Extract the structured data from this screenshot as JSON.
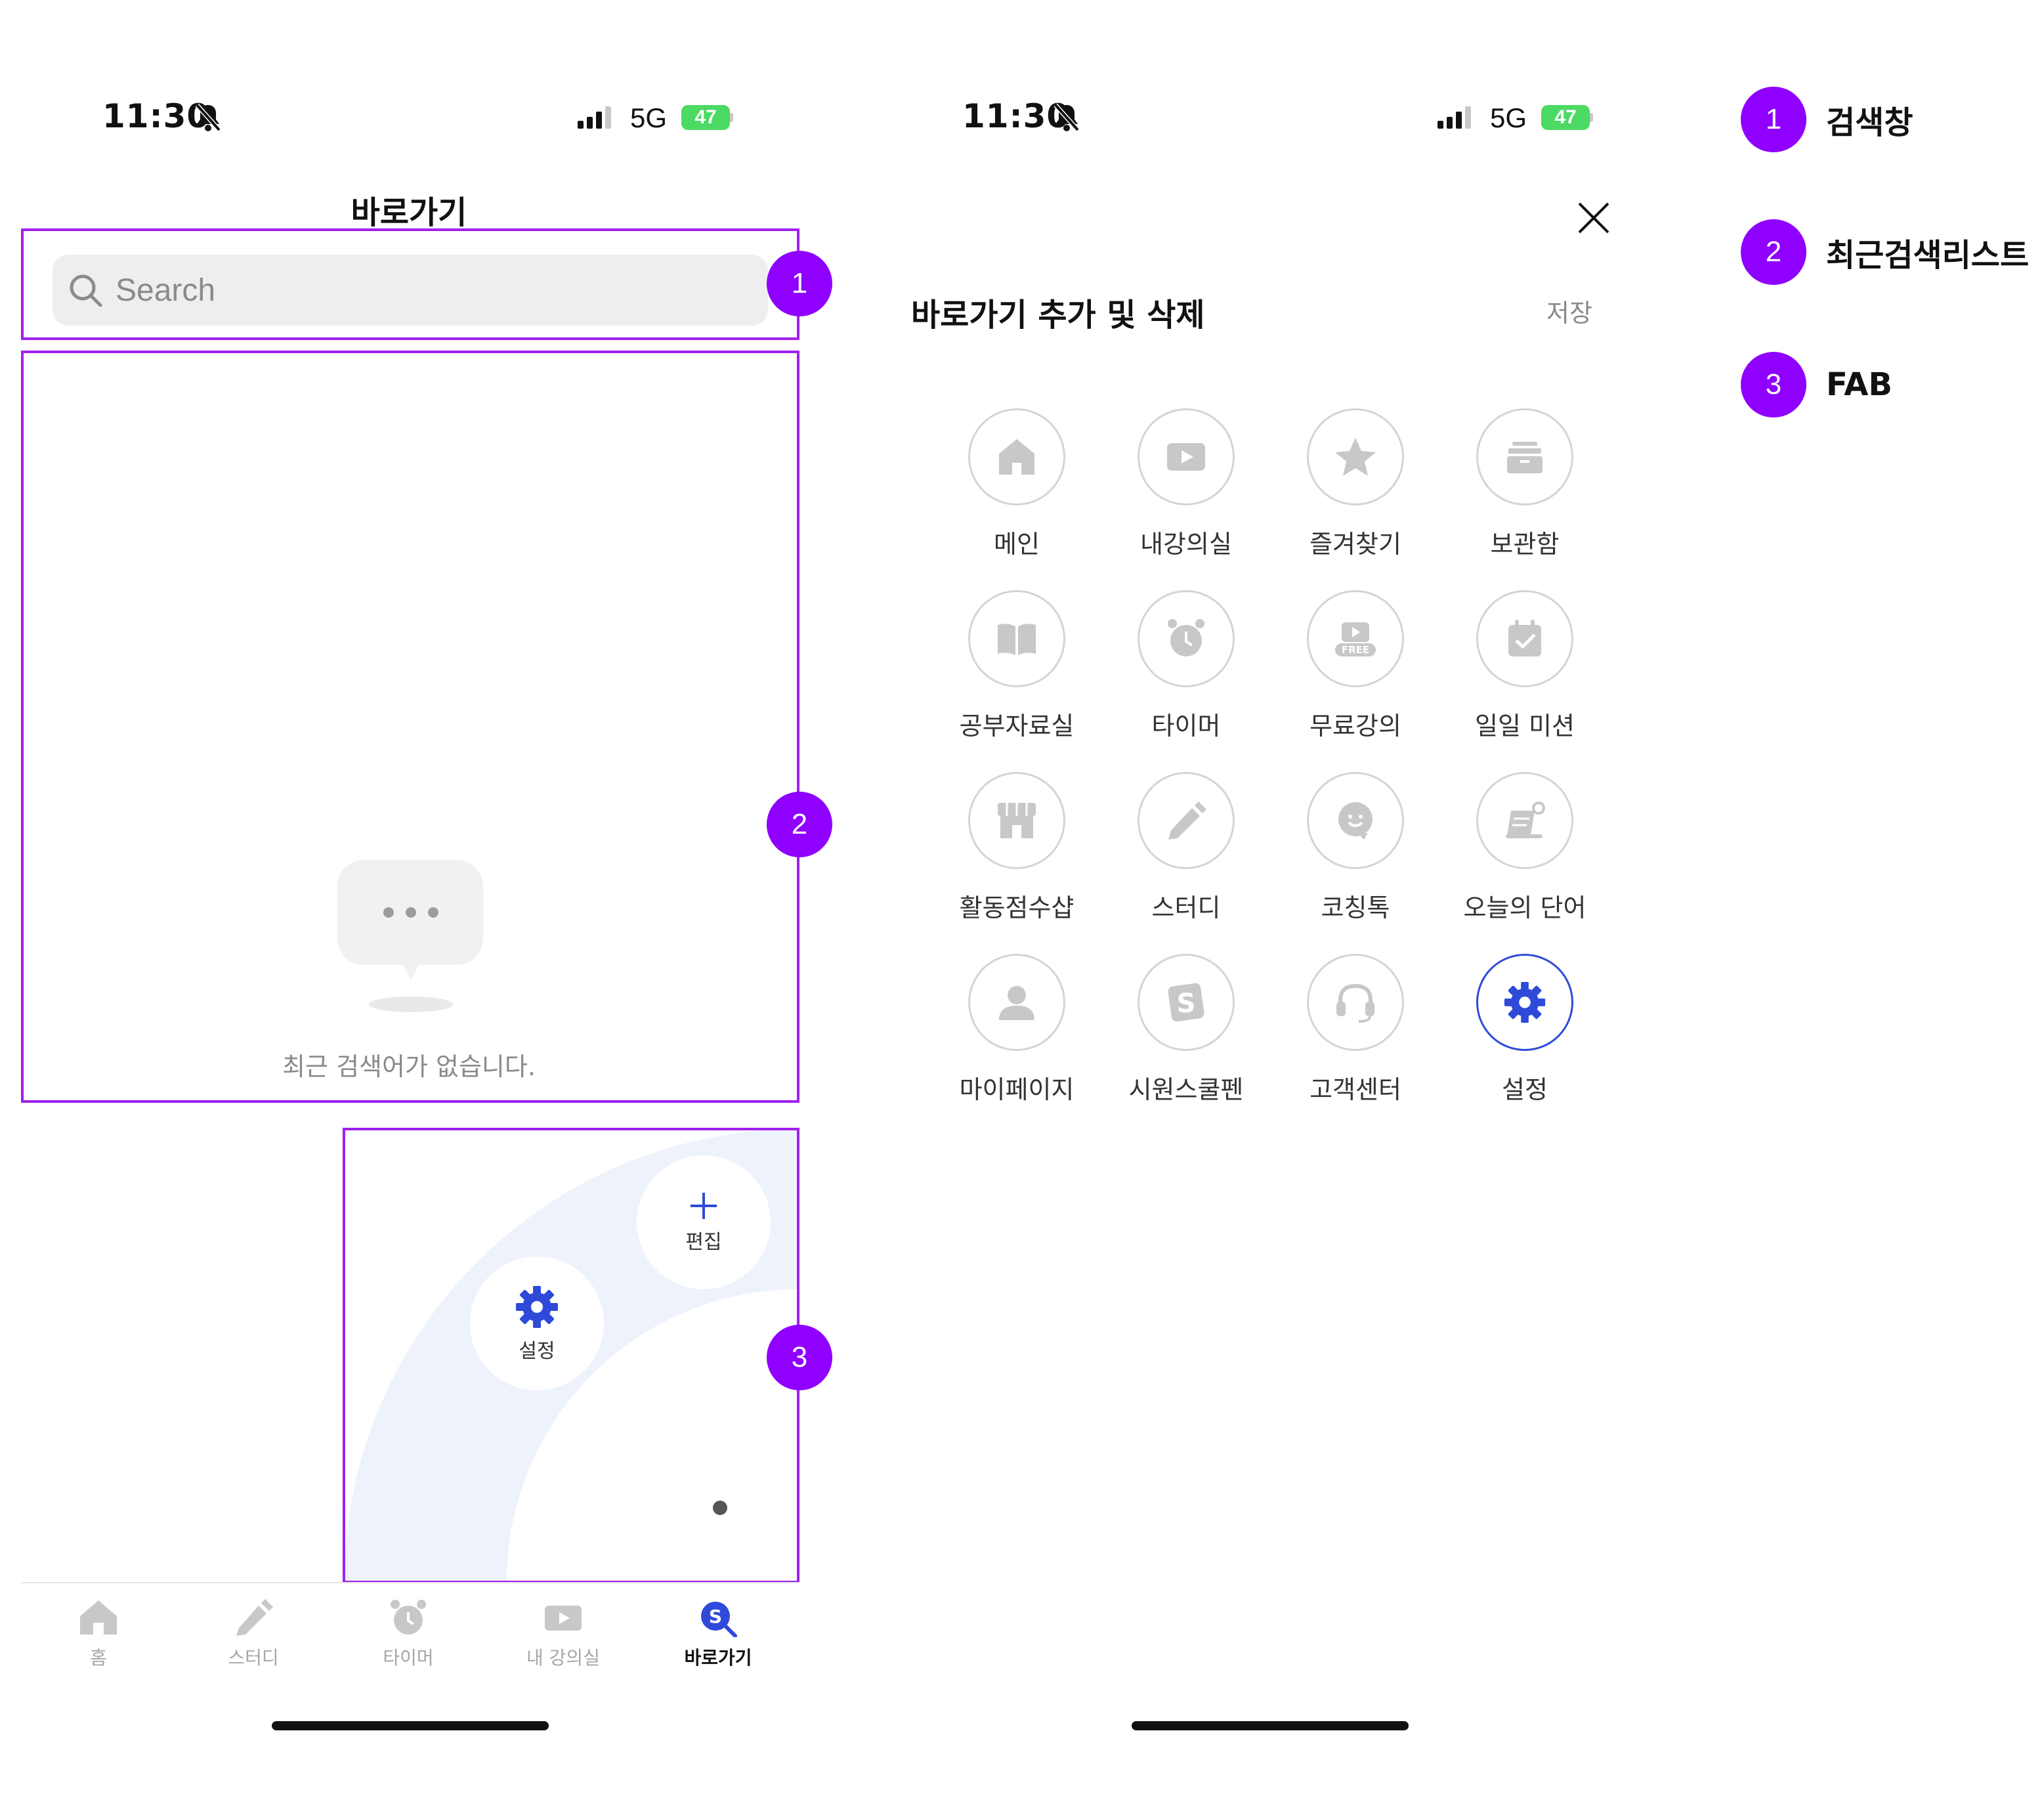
{
  "left_screen": {
    "status": {
      "time": "11:30",
      "network": "5G",
      "battery": "47"
    },
    "page_title": "바로가기",
    "search": {
      "placeholder": "Search"
    },
    "recent": {
      "empty_text": "최근 검색어가 없습니다."
    },
    "fab": {
      "edit_label": "편집",
      "settings_label": "설정"
    },
    "tabbar": [
      {
        "label": "홈",
        "icon": "home-icon"
      },
      {
        "label": "스터디",
        "icon": "pencil-icon"
      },
      {
        "label": "타이머",
        "icon": "alarm-clock-icon"
      },
      {
        "label": "내 강의실",
        "icon": "play-icon"
      },
      {
        "label": "바로가기",
        "icon": "shortcut-search-icon",
        "active": true
      }
    ]
  },
  "right_screen": {
    "status": {
      "time": "11:30",
      "network": "5G",
      "battery": "47"
    },
    "title": "바로가기 추가 및 삭제",
    "save_label": "저장",
    "grid": [
      {
        "label": "메인",
        "icon": "house-icon"
      },
      {
        "label": "내강의실",
        "icon": "play-icon"
      },
      {
        "label": "즐겨찾기",
        "icon": "star-icon"
      },
      {
        "label": "보관함",
        "icon": "archive-icon"
      },
      {
        "label": "공부자료실",
        "icon": "book-icon"
      },
      {
        "label": "타이머",
        "icon": "alarm-clock-icon"
      },
      {
        "label": "무료강의",
        "icon": "free-play-icon",
        "icon_text": "FREE"
      },
      {
        "label": "일일 미션",
        "icon": "calendar-check-icon"
      },
      {
        "label": "활동점수샵",
        "icon": "store-icon"
      },
      {
        "label": "스터디",
        "icon": "pencil-icon"
      },
      {
        "label": "코칭톡",
        "icon": "chat-smile-icon"
      },
      {
        "label": "오늘의 단어",
        "icon": "word-note-icon"
      },
      {
        "label": "마이페이지",
        "icon": "person-icon"
      },
      {
        "label": "시원스쿨펜",
        "icon": "siwon-s-icon"
      },
      {
        "label": "고객센터",
        "icon": "headset-icon"
      },
      {
        "label": "설정",
        "icon": "gear-icon",
        "active": true
      }
    ]
  },
  "legend": [
    {
      "number": "1",
      "label": "검색창"
    },
    {
      "number": "2",
      "label": "최근검색리스트"
    },
    {
      "number": "3",
      "label": "FAB"
    }
  ],
  "annotation_badges": [
    "1",
    "2",
    "3"
  ],
  "colors": {
    "highlight": "#a020f0",
    "badge": "#8f00ff",
    "accent": "#2f4ad9",
    "icon_gray": "#c8c8c8"
  }
}
